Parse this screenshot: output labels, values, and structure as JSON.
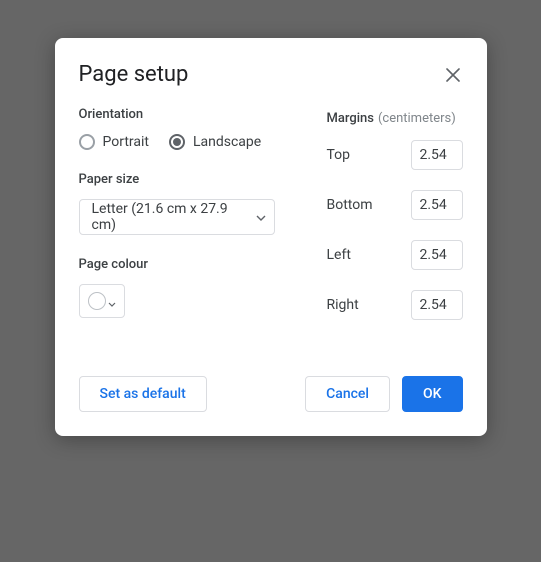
{
  "dialog": {
    "title": "Page setup"
  },
  "orientation": {
    "label": "Orientation",
    "portrait": "Portrait",
    "landscape": "Landscape",
    "selected": "landscape"
  },
  "paper": {
    "label": "Paper size",
    "value": "Letter (21.6 cm x 27.9 cm)"
  },
  "pageColor": {
    "label": "Page colour",
    "value": "#ffffff"
  },
  "margins": {
    "label": "Margins",
    "unit": "(centimeters)",
    "top": {
      "label": "Top",
      "value": "2.54"
    },
    "bottom": {
      "label": "Bottom",
      "value": "2.54"
    },
    "left": {
      "label": "Left",
      "value": "2.54"
    },
    "right": {
      "label": "Right",
      "value": "2.54"
    }
  },
  "buttons": {
    "setDefault": "Set as default",
    "cancel": "Cancel",
    "ok": "OK"
  }
}
